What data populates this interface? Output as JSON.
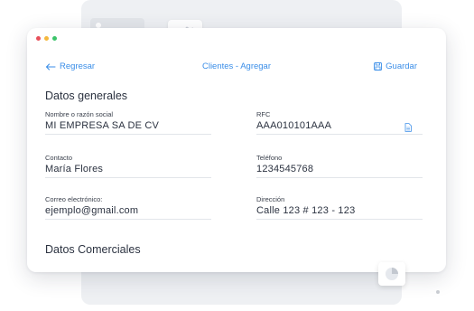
{
  "header": {
    "back_label": "Regresar",
    "breadcrumb": "Clientes - Agregar",
    "save_label": "Guardar"
  },
  "sections": {
    "general_title": "Datos generales",
    "commercial_title": "Datos Comerciales"
  },
  "fields": {
    "name": {
      "label": "Nombre o razón social",
      "value": "MI EMPRESA SA DE CV"
    },
    "rfc": {
      "label": "RFC",
      "value": "AAA010101AAA"
    },
    "contact": {
      "label": "Contacto",
      "value": "María Flores"
    },
    "phone": {
      "label": "Teléfono",
      "value": "1234545768"
    },
    "email": {
      "label": "Correo electrónico:",
      "value": "ejemplo@gmail.com"
    },
    "address": {
      "label": "Dirección",
      "value": "Calle 123 # 123 - 123"
    }
  },
  "icons": {
    "back": "arrow-left-icon",
    "save": "floppy-disk-icon",
    "rfc_action": "document-icon",
    "chart": "pie-chart-icon"
  },
  "colors": {
    "accent": "#3b8ee8",
    "window_red": "#e8505b",
    "window_yellow": "#f5b83d",
    "window_green": "#3cc46a"
  }
}
